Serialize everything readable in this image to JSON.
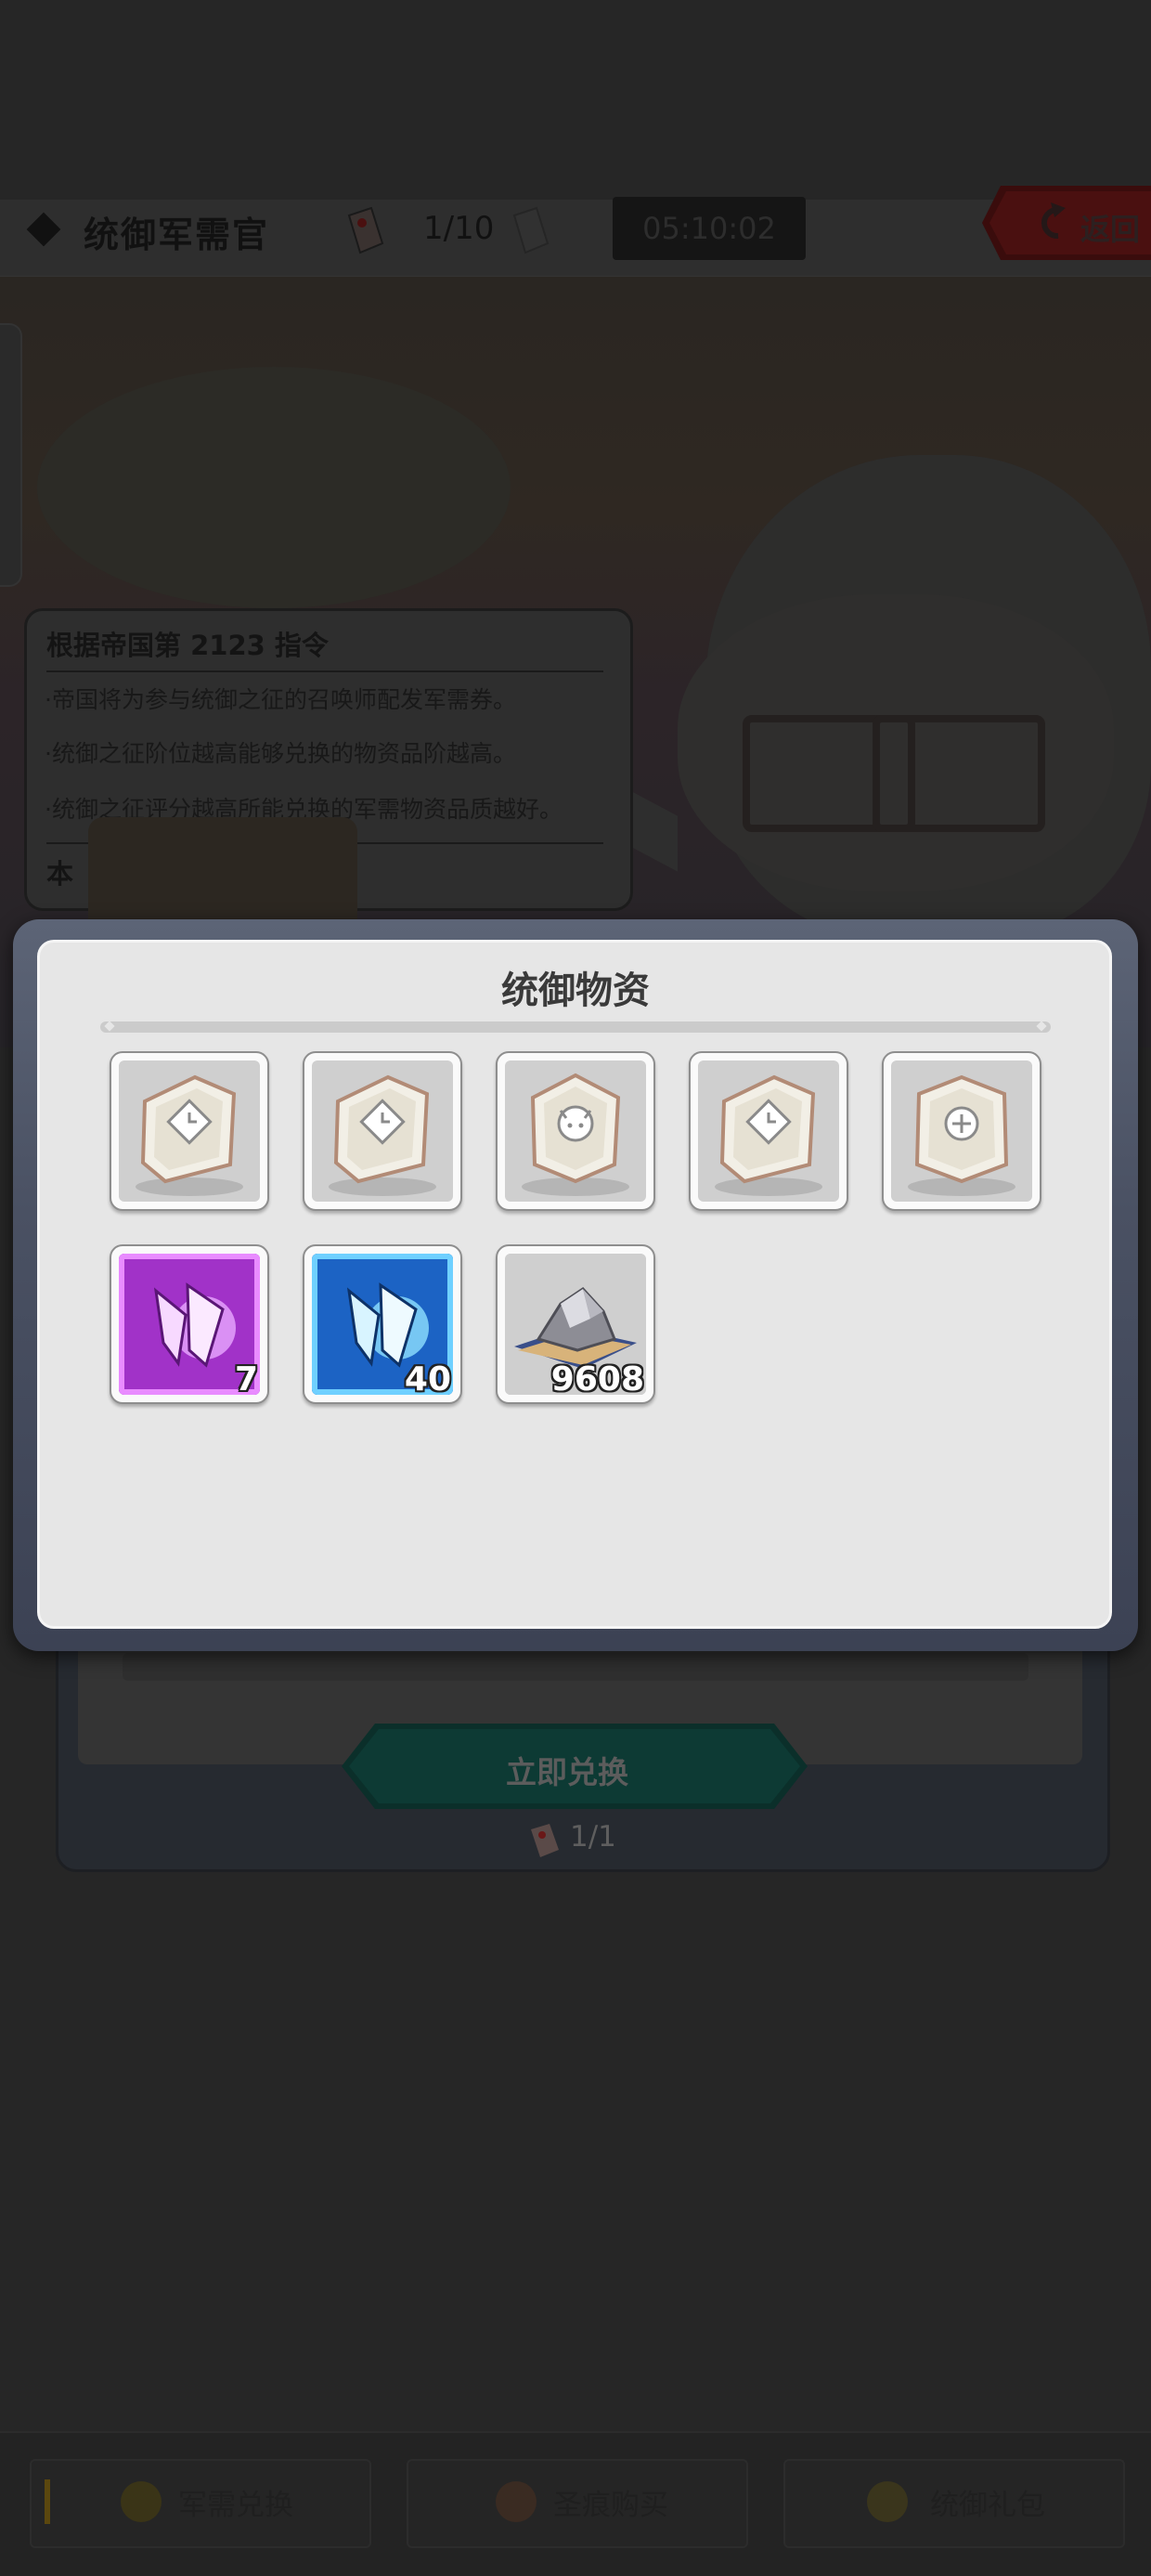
{
  "header": {
    "title": "统御军需官",
    "ticket_count": "1/10",
    "timer": "05:10:02",
    "back_label": "返回"
  },
  "notice": {
    "title": "根据帝国第 2123 指令",
    "lines": [
      "帝国将为参与统御之征的召唤师配发军需券。",
      "统御之征阶位越高能够兑换的物资品阶越高。",
      "统御之征评分越高所能兑换的军需物资品质越好。"
    ],
    "footer": "本"
  },
  "exchange": {
    "button_label": "立即兑换",
    "cost": "1/1"
  },
  "modal": {
    "title": "统御物资",
    "items": [
      {
        "icon": "shard-clock-icon",
        "count": ""
      },
      {
        "icon": "shard-clock-icon",
        "count": ""
      },
      {
        "icon": "shard-beast-icon",
        "count": ""
      },
      {
        "icon": "shard-clock-icon",
        "count": ""
      },
      {
        "icon": "shard-plus-icon",
        "count": ""
      },
      {
        "icon": "purple-crystal-icon",
        "count": "7"
      },
      {
        "icon": "blue-crystal-icon",
        "count": "40"
      },
      {
        "icon": "ore-pile-icon",
        "count": "9608"
      }
    ]
  },
  "bottom_nav": {
    "tabs": [
      {
        "label": "军需兑换",
        "icon": "coin-icon"
      },
      {
        "label": "圣痕购买",
        "icon": "stigmata-icon"
      },
      {
        "label": "统御礼包",
        "icon": "gift-icon"
      }
    ]
  },
  "colors": {
    "modal_frame": "#4a5163",
    "modal_body": "#e6e6e6",
    "purple_item": "#b03bd6",
    "blue_item": "#1d6fd1",
    "exchange_button": "#0d4a42",
    "back_button": "#8a0c0c"
  }
}
